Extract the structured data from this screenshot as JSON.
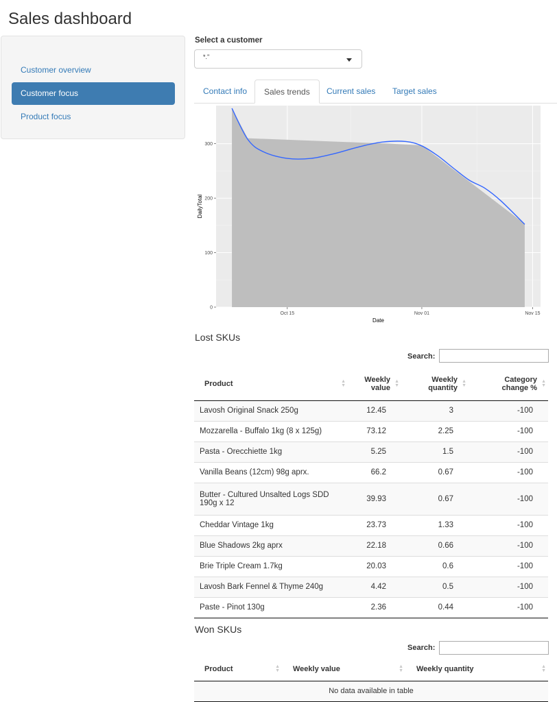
{
  "app": {
    "title": "Sales dashboard"
  },
  "sidebar": {
    "items": [
      {
        "label": "Customer overview",
        "active": false
      },
      {
        "label": "Customer focus",
        "active": true
      },
      {
        "label": "Product focus",
        "active": false
      }
    ]
  },
  "customer_select": {
    "label": "Select a customer",
    "value": "*.''"
  },
  "tabs": [
    {
      "label": "Contact info",
      "active": false
    },
    {
      "label": "Sales trends",
      "active": true
    },
    {
      "label": "Current sales",
      "active": false
    },
    {
      "label": "Target sales",
      "active": false
    }
  ],
  "chart_data": {
    "type": "area",
    "title": "",
    "xlabel": "Date",
    "ylabel": "DailyTotal",
    "x_ticks": [
      "Oct 15",
      "Nov 01",
      "Nov 15"
    ],
    "y_ticks": [
      0,
      100,
      200,
      300
    ],
    "ylim": [
      0,
      370
    ],
    "xlim": [
      "2019-10-06",
      "2019-11-16"
    ],
    "grid": true,
    "area_series": {
      "x": [
        "2019-10-08",
        "2019-10-10",
        "2019-10-28",
        "2019-11-01",
        "2019-11-14"
      ],
      "y": [
        365,
        310,
        300,
        297,
        153
      ]
    },
    "smooth_series": {
      "color": "#3366ff",
      "x": [
        "2019-10-08",
        "2019-10-10",
        "2019-10-12",
        "2019-10-15",
        "2019-10-18",
        "2019-10-21",
        "2019-10-24",
        "2019-10-27",
        "2019-10-30",
        "2019-11-01",
        "2019-11-03",
        "2019-11-05",
        "2019-11-07",
        "2019-11-09",
        "2019-11-11",
        "2019-11-14"
      ],
      "y": [
        365,
        308,
        285,
        273,
        273,
        282,
        294,
        303,
        304,
        296,
        278,
        255,
        233,
        218,
        195,
        152
      ]
    }
  },
  "lost_skus": {
    "title": "Lost SKUs",
    "search_label": "Search:",
    "columns": [
      {
        "lines": [
          "Product"
        ]
      },
      {
        "lines": [
          "Weekly",
          "value"
        ]
      },
      {
        "lines": [
          "Weekly",
          "quantity"
        ]
      },
      {
        "lines": [
          "Category",
          "change %"
        ]
      }
    ],
    "rows": [
      [
        "Lavosh Original Snack 250g",
        "12.45",
        "3",
        "-100"
      ],
      [
        "Mozzarella - Buffalo 1kg (8 x 125g)",
        "73.12",
        "2.25",
        "-100"
      ],
      [
        "Pasta - Orecchiette 1kg",
        "5.25",
        "1.5",
        "-100"
      ],
      [
        "Vanilla Beans (12cm) 98g aprx.",
        "66.2",
        "0.67",
        "-100"
      ],
      [
        "Butter - Cultured Unsalted Logs SDD 190g x 12",
        "39.93",
        "0.67",
        "-100"
      ],
      [
        "Cheddar Vintage 1kg",
        "23.73",
        "1.33",
        "-100"
      ],
      [
        "Blue Shadows 2kg aprx",
        "22.18",
        "0.66",
        "-100"
      ],
      [
        "Brie Triple Cream 1.7kg",
        "20.03",
        "0.6",
        "-100"
      ],
      [
        "Lavosh Bark Fennel & Thyme 240g",
        "4.42",
        "0.5",
        "-100"
      ],
      [
        "Paste - Pinot 130g",
        "2.36",
        "0.44",
        "-100"
      ]
    ]
  },
  "won_skus": {
    "title": "Won SKUs",
    "search_label": "Search:",
    "columns": [
      "Product",
      "Weekly value",
      "Weekly quantity"
    ],
    "empty_message": "No data available in table"
  }
}
